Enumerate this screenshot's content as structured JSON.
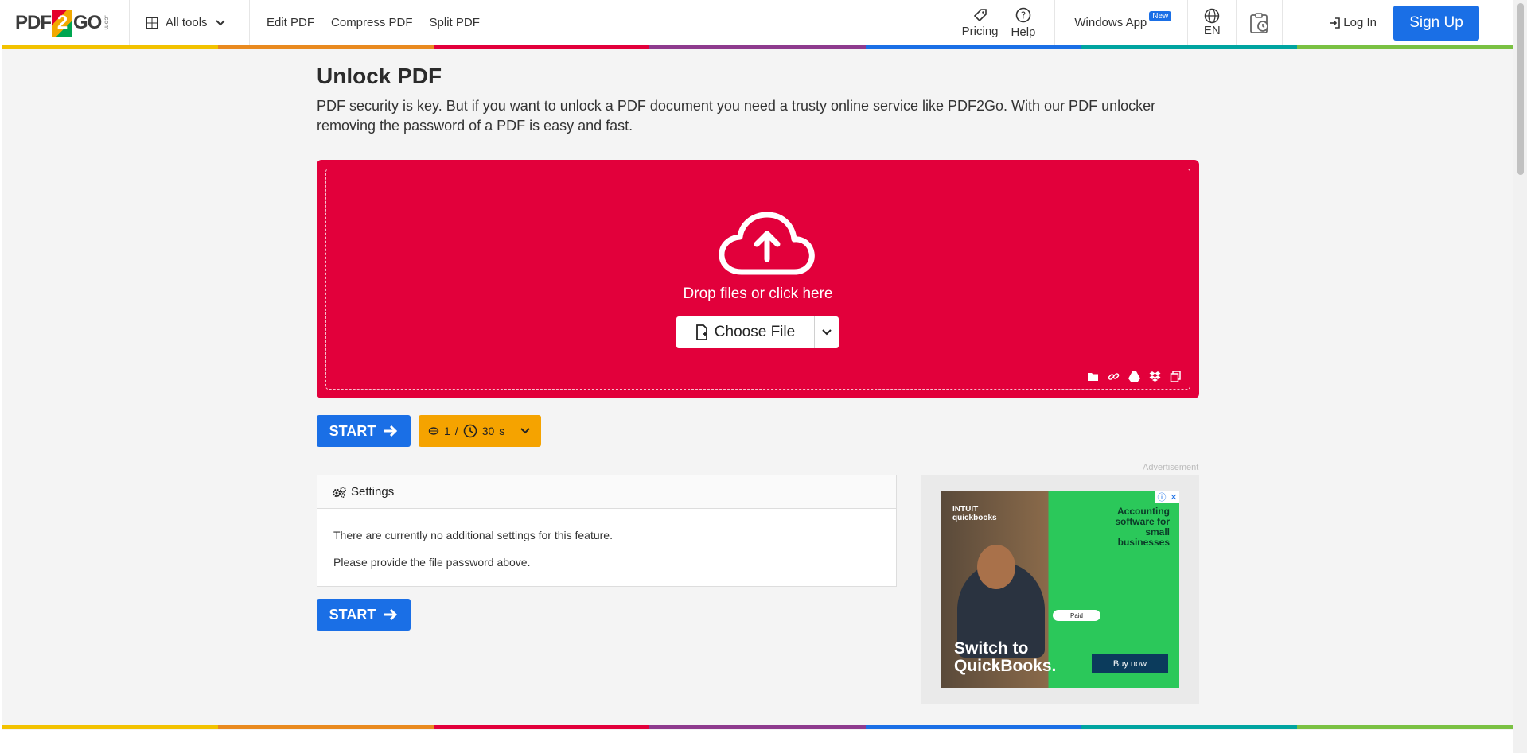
{
  "header": {
    "logo": {
      "left": "PDF",
      "mid": "2",
      "right": "GO",
      "suffix": ".com"
    },
    "all_tools": "All tools",
    "nav": [
      "Edit PDF",
      "Compress PDF",
      "Split PDF"
    ],
    "pricing": "Pricing",
    "help": "Help",
    "windows_app": "Windows App",
    "new_badge": "New",
    "language": "EN",
    "login": "Log In",
    "signup": "Sign Up"
  },
  "page": {
    "title": "Unlock PDF",
    "description": "PDF security is key. But if you want to unlock a PDF document you need a trusty online service like PDF2Go. With our PDF unlocker removing the password of a PDF is easy and fast."
  },
  "dropzone": {
    "prompt": "Drop files or click here",
    "choose_file": "Choose File",
    "sources": [
      "folder-icon",
      "link-icon",
      "google-drive-icon",
      "dropbox-icon",
      "clipboard-icon"
    ]
  },
  "actions": {
    "start": "START",
    "credits_count": "1",
    "credits_sep": "/",
    "credits_time": "30",
    "credits_unit": "s"
  },
  "settings": {
    "heading": "Settings",
    "line1": "There are currently no additional settings for this feature.",
    "line2": "Please provide the file password above."
  },
  "ad": {
    "label": "Advertisement",
    "brand_line1": "INTUIT",
    "brand_line2": "quickbooks",
    "tagline": "Accounting software for small businesses",
    "headline_line1": "Switch to",
    "headline_line2": "QuickBooks.",
    "cta": "Buy now",
    "paid_label": "Paid"
  },
  "colors": {
    "accent": "#1a6fe6",
    "dropzone": "#e2003b",
    "credits": "#f5a300",
    "rainbow": [
      "#f2c200",
      "#e98a1f",
      "#e2003b",
      "#8e3b8e",
      "#1a6fe6",
      "#00a4a0",
      "#7ac143"
    ]
  }
}
